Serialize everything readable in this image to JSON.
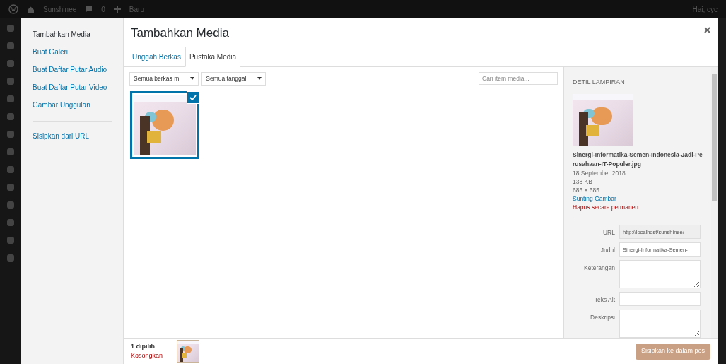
{
  "admin_bar": {
    "site": "Sunshinee",
    "comments": "0",
    "new": "Baru",
    "greeting": "Hai, cyc"
  },
  "menu": {
    "items": [
      {
        "label": "Tambahkan Media",
        "selected": true
      },
      {
        "label": "Buat Galeri",
        "selected": false
      },
      {
        "label": "Buat Daftar Putar Audio",
        "selected": false
      },
      {
        "label": "Buat Daftar Putar Video",
        "selected": false
      },
      {
        "label": "Gambar Unggulan",
        "selected": false
      }
    ],
    "url_item": "Sisipkan dari URL"
  },
  "modal": {
    "title": "Tambahkan Media",
    "tabs": [
      {
        "label": "Unggah Berkas",
        "selected": false
      },
      {
        "label": "Pustaka Media",
        "selected": true
      }
    ],
    "filters": [
      {
        "value": "Semua berkas m"
      },
      {
        "value": "Semua tanggal"
      }
    ],
    "search": {
      "placeholder": "Cari item media..."
    },
    "attachments": [
      {
        "selected": true
      }
    ],
    "details": {
      "heading": "DETIL LAMPIRAN",
      "filename": "Sinergi-Informatika-Semen-Indonesia-Jadi-Perusahaan-IT-Populer.jpg",
      "date": "18 September 2018",
      "size": "138 KB",
      "dimensions": "686 × 685",
      "edit_link": "Sunting Gambar",
      "delete_link": "Hapus secara permanen",
      "fields": [
        {
          "kind": "text",
          "label": "URL",
          "value": "http://localhost/sunshinee/",
          "disabled": true
        },
        {
          "kind": "text",
          "label": "Judul",
          "value": "Sinergi-Informatika-Semen-",
          "disabled": false
        },
        {
          "kind": "textarea",
          "label": "Keterangan",
          "disabled": false
        },
        {
          "kind": "text",
          "label": "Teks Alt",
          "disabled": false
        },
        {
          "kind": "textarea",
          "label": "Deskripsi",
          "disabled": false
        }
      ]
    },
    "footer": {
      "count": "1 dipilih",
      "clear": "Kosongkan",
      "button": "Sisipkan ke dalam pos"
    }
  }
}
